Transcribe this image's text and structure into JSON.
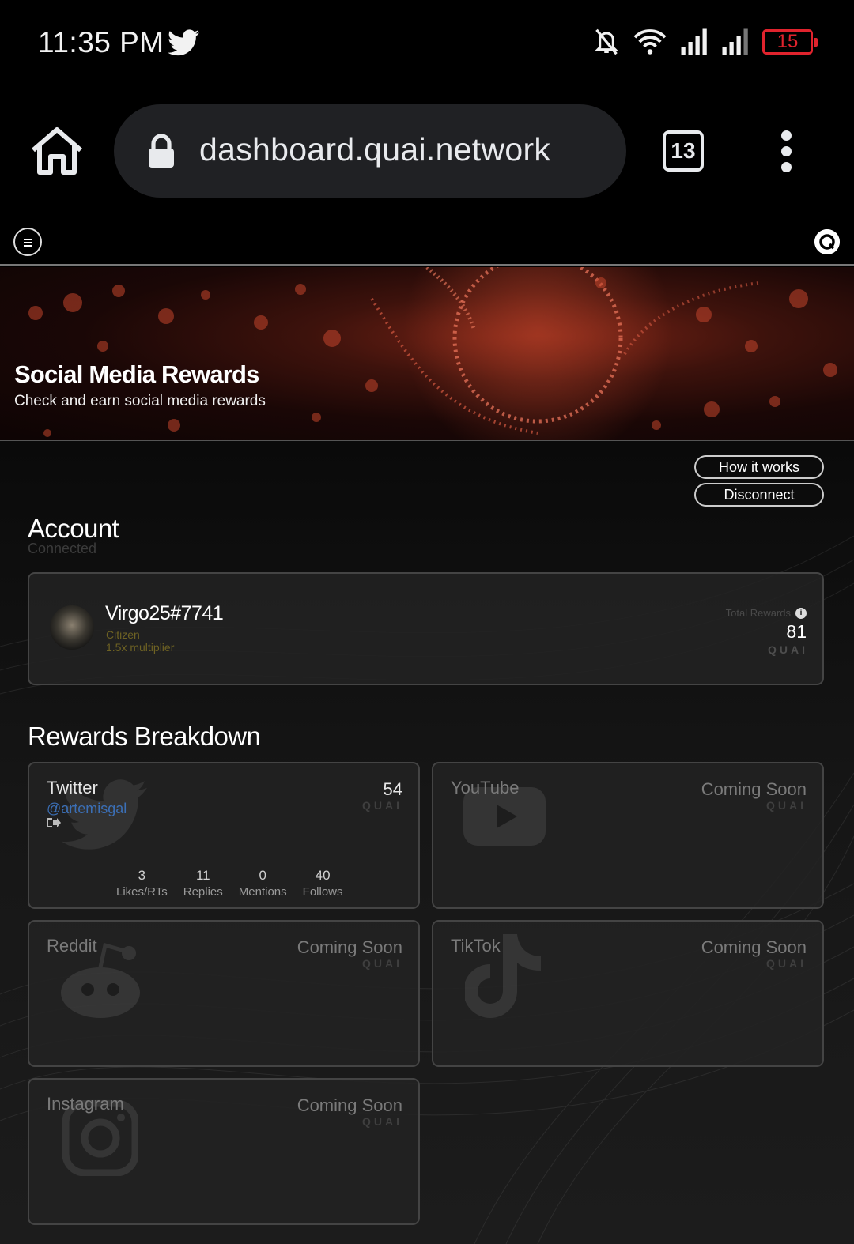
{
  "status_bar": {
    "time": "11:35 PM",
    "battery": "15",
    "icons": [
      "twitter-icon",
      "bell-off-icon",
      "wifi-icon",
      "signal-icon",
      "signal-icon",
      "battery-icon"
    ]
  },
  "browser": {
    "url": "dashboard.quai.network",
    "tab_count": "13"
  },
  "hero": {
    "title": "Social Media Rewards",
    "subtitle": "Check and earn social media rewards"
  },
  "actions": {
    "how_it_works": "How it works",
    "disconnect": "Disconnect"
  },
  "account": {
    "title": "Account",
    "status": "Connected",
    "username": "Virgo25#7741",
    "rank": "Citizen",
    "multiplier": "1.5x multiplier",
    "total_rewards_label": "Total Rewards",
    "total_rewards_value": "81",
    "unit": "QUAI"
  },
  "rewards": {
    "title": "Rewards Breakdown",
    "unit": "QUAI",
    "twitter": {
      "name": "Twitter",
      "value": "54",
      "handle": "@artemisgal",
      "stats": [
        {
          "value": "3",
          "label": "Likes/RTs"
        },
        {
          "value": "11",
          "label": "Replies"
        },
        {
          "value": "0",
          "label": "Mentions"
        },
        {
          "value": "40",
          "label": "Follows"
        }
      ]
    },
    "youtube": {
      "name": "YouTube",
      "value": "Coming Soon"
    },
    "reddit": {
      "name": "Reddit",
      "value": "Coming Soon"
    },
    "tiktok": {
      "name": "TikTok",
      "value": "Coming Soon"
    },
    "instagram": {
      "name": "Instagram",
      "value": "Coming Soon"
    }
  },
  "colors": {
    "accent_gold": "#6e6223",
    "handle_blue": "#3b6fb6",
    "battery_red": "#e0232d",
    "hero_red": "#7a2416"
  }
}
